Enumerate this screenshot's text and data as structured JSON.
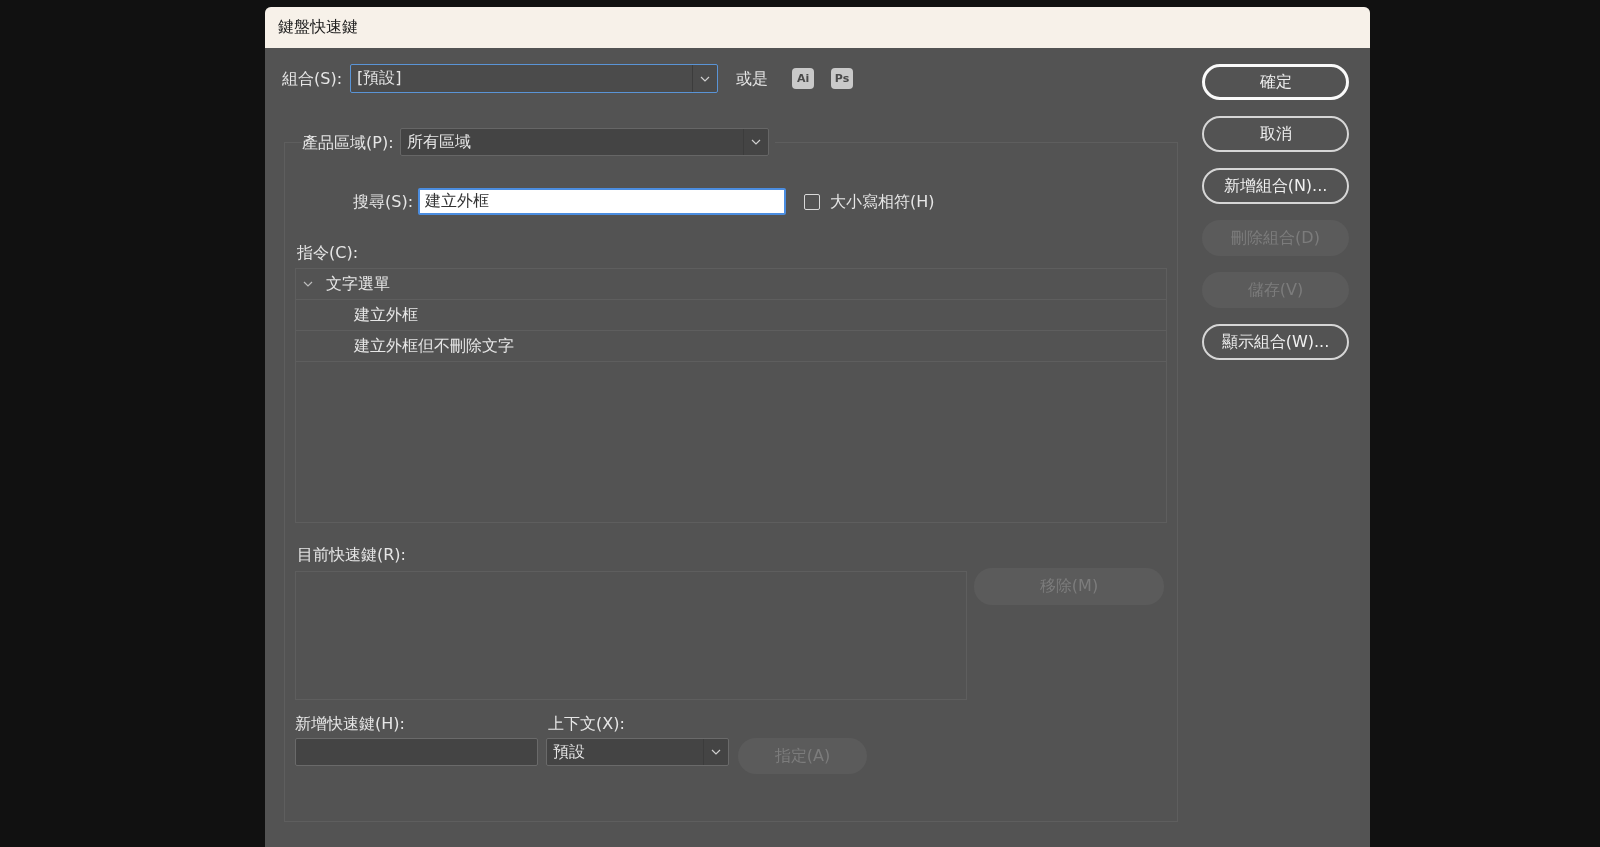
{
  "window": {
    "title": "鍵盤快速鍵"
  },
  "set": {
    "label": "組合(S):",
    "value": "[預設]",
    "focused": true
  },
  "or_label": "或是",
  "app_buttons": [
    "Ai",
    "Ps"
  ],
  "product_area": {
    "label": "產品區域(P):",
    "value": "所有區域"
  },
  "search": {
    "label": "搜尋(S):",
    "value": "建立外框",
    "focused": true
  },
  "case_sensitive": {
    "label": "大小寫相符(H)",
    "checked": false
  },
  "commands": {
    "label": "指令(C):",
    "items": [
      {
        "label": "文字選單",
        "expanded": true,
        "selected": false,
        "children": [
          {
            "label": "建立外框",
            "selected": false
          },
          {
            "label": "建立外框但不刪除文字",
            "selected": false
          }
        ]
      }
    ]
  },
  "current_shortcuts": {
    "label": "目前快速鍵(R):",
    "remove_button": {
      "label": "移除(M)",
      "disabled": true
    }
  },
  "new_shortcut": {
    "label": "新增快速鍵(H):"
  },
  "context": {
    "label": "上下文(X):",
    "value": "預設"
  },
  "assign_button": {
    "label": "指定(A)",
    "disabled": true
  },
  "buttons": [
    {
      "label": "確定",
      "default": true,
      "disabled": false
    },
    {
      "label": "取消",
      "default": false,
      "disabled": false
    },
    {
      "label": "新增組合(N)...",
      "default": false,
      "disabled": false
    },
    {
      "label": "刪除組合(D)",
      "default": false,
      "disabled": true
    },
    {
      "label": "儲存(V)",
      "default": false,
      "disabled": true
    },
    {
      "label": "顯示組合(W)...",
      "default": false,
      "disabled": false
    }
  ]
}
